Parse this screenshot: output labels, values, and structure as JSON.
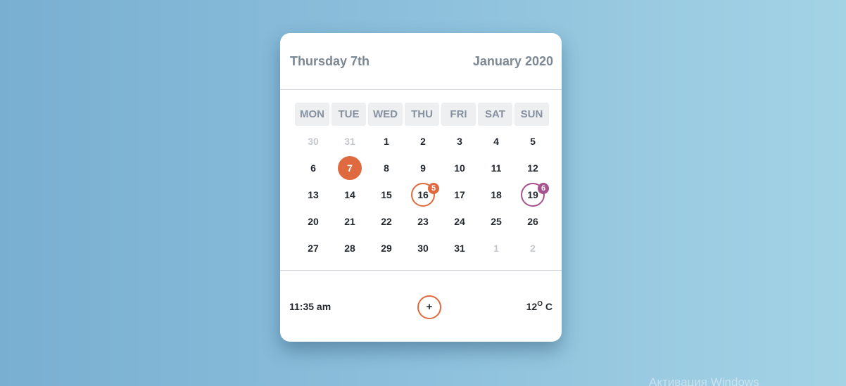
{
  "header": {
    "day_label": "Thursday 7th",
    "month_label": "January 2020"
  },
  "weekdays": [
    "MON",
    "TUE",
    "WED",
    "THU",
    "FRI",
    "SAT",
    "SUN"
  ],
  "weeks": [
    [
      {
        "n": "30",
        "muted": true
      },
      {
        "n": "31",
        "muted": true
      },
      {
        "n": "1"
      },
      {
        "n": "2"
      },
      {
        "n": "3"
      },
      {
        "n": "4"
      },
      {
        "n": "5"
      }
    ],
    [
      {
        "n": "6"
      },
      {
        "n": "7",
        "today": true
      },
      {
        "n": "8"
      },
      {
        "n": "9"
      },
      {
        "n": "10"
      },
      {
        "n": "11"
      },
      {
        "n": "12"
      }
    ],
    [
      {
        "n": "13"
      },
      {
        "n": "14"
      },
      {
        "n": "15"
      },
      {
        "n": "16",
        "event": "orange",
        "badge": "5"
      },
      {
        "n": "17"
      },
      {
        "n": "18"
      },
      {
        "n": "19",
        "event": "purple",
        "badge": "6"
      }
    ],
    [
      {
        "n": "20"
      },
      {
        "n": "21"
      },
      {
        "n": "22"
      },
      {
        "n": "23"
      },
      {
        "n": "24"
      },
      {
        "n": "25"
      },
      {
        "n": "26"
      }
    ],
    [
      {
        "n": "27"
      },
      {
        "n": "28"
      },
      {
        "n": "29"
      },
      {
        "n": "30"
      },
      {
        "n": "31"
      },
      {
        "n": "1",
        "muted": true
      },
      {
        "n": "2",
        "muted": true
      }
    ]
  ],
  "footer": {
    "time": "11:35 am",
    "add_label": "+",
    "temp_value": "12",
    "temp_degree": "O",
    "temp_unit": " C"
  },
  "colors": {
    "accent": "#e06a40",
    "event_purple": "#a6528e",
    "header_text": "#7c8794"
  },
  "watermark": "Активация Windows"
}
